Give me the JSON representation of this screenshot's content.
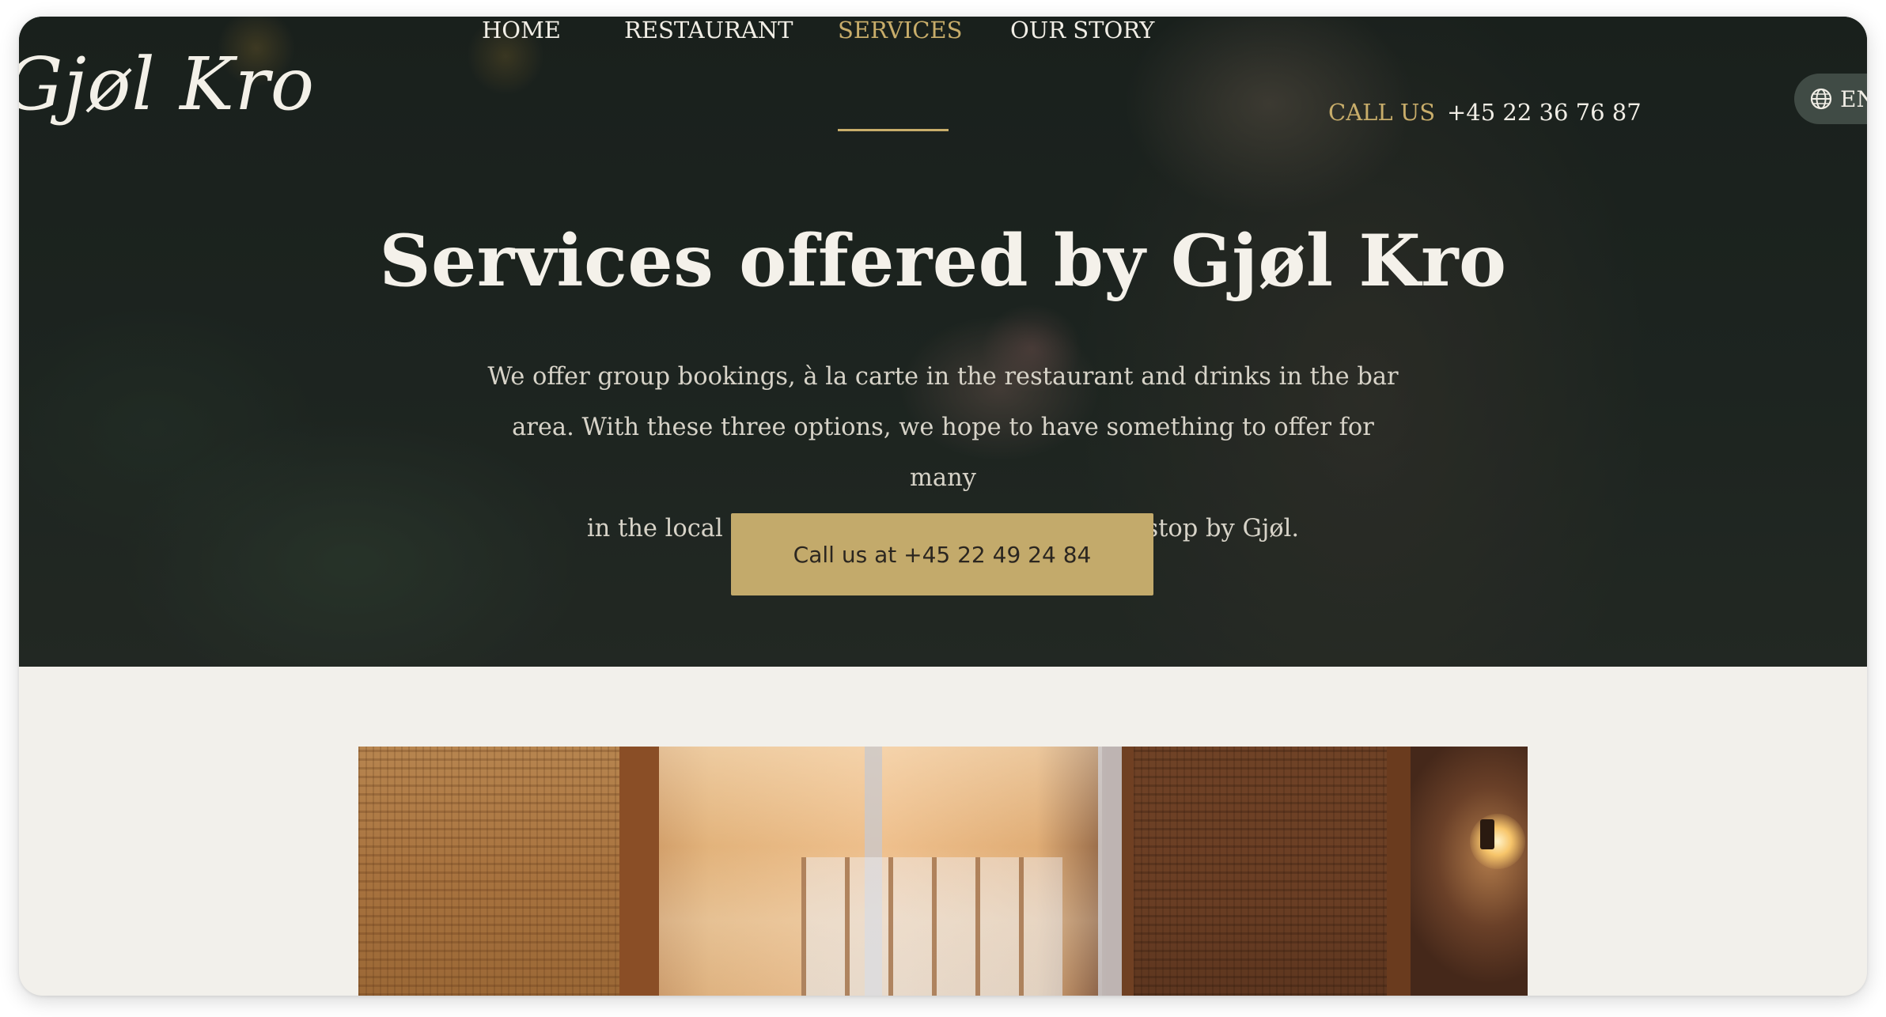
{
  "brand": {
    "logo_text": "Gjøl Kro"
  },
  "nav": {
    "items": [
      {
        "label": "HOME",
        "active": false
      },
      {
        "label": "RESTAURANT",
        "active": false
      },
      {
        "label": "SERVICES",
        "active": true
      },
      {
        "label": "OUR STORY",
        "active": false
      }
    ],
    "call_label": "CALL US",
    "call_number": "+45 22 36 76 87",
    "language": "EN"
  },
  "hero": {
    "title": "Services offered by Gjøl Kro",
    "subtitle_lines": [
      "We offer group bookings, à la carte in the restaurant and drinks in the bar",
      "area. With these three options, we hope to have something to offer for many",
      "in the local area but also sailing tourists who stop by Gjøl."
    ],
    "cta_label": "Call us at +45 22 49 24 84"
  },
  "colors": {
    "accent_gold": "#c8ad6a",
    "cta_background": "#c3aa6b",
    "page_background": "#f2f0eb",
    "hero_background": "#1f2621"
  },
  "icons": {
    "language": "globe-icon"
  }
}
